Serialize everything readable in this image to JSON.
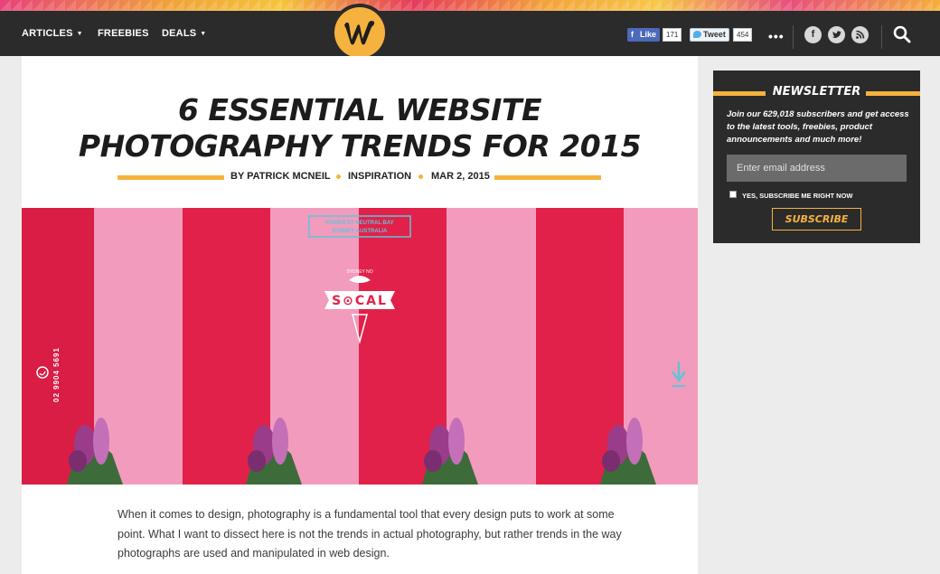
{
  "nav": {
    "items": [
      {
        "label": "ARTICLES",
        "caret": "▼"
      },
      {
        "label": "FREEBIES",
        "caret": ""
      },
      {
        "label": "DEALS",
        "caret": "▼"
      }
    ],
    "like_label": "Like",
    "like_count": "171",
    "tweet_label": "Tweet",
    "tweet_count": "454",
    "more_label": "•••",
    "social_icons": [
      "facebook-icon",
      "twitter-icon",
      "rss-icon"
    ]
  },
  "article": {
    "title_line1": "6 ESSENTIAL WEBSITE",
    "title_line2": "PHOTOGRAPHY TRENDS FOR 2015",
    "author": "BY PATRICK MCNEIL",
    "category": "INSPIRATION",
    "date": "MAR 2, 2015",
    "hero": {
      "sign_line1": "FISHER ST NEUTRAL BAY",
      "sign_line2": "SYDNEY AUSTRALIA",
      "logo_small": "SYDNEY NO",
      "logo_text": "S⊙CAL",
      "phone": "02 9904 5691"
    },
    "body": "When it comes to design, photography is a fundamental tool that every design puts to work at some point. What I want to dissect here is not the trends in actual photography, but rather trends in the way photographs are used and manipulated in web design."
  },
  "newsletter": {
    "title": "NEWSLETTER",
    "description": "Join our 629,018 subscribers and get access to the latest tools, freebies, product announcements and much more!",
    "email_placeholder": "Enter email address",
    "checkbox_label": "YES, SUBSCRIBE ME RIGHT NOW",
    "button_label": "SUBSCRIBE"
  },
  "colors": {
    "accent": "#f6b23e",
    "navbar": "#2b2b2b",
    "hero_red": "#e2214a",
    "hero_pink": "#f29bbd"
  }
}
